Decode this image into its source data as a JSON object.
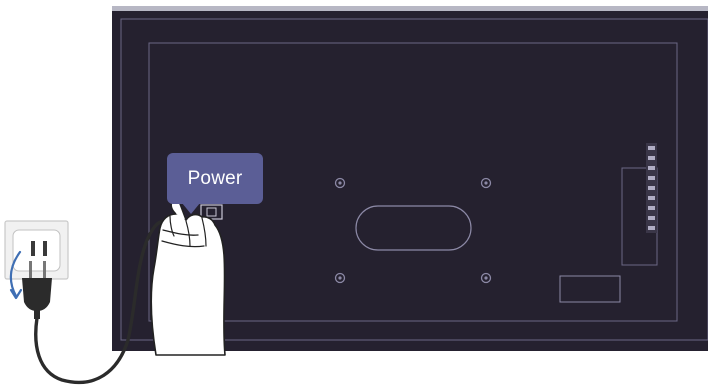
{
  "callout": {
    "label": "Power"
  },
  "colors": {
    "tv_back": "#25212f",
    "tv_edge": "#b5b5c3",
    "inner_line": "#6b6886",
    "callout_bg": "#5b5e96",
    "callout_text": "#ffffff",
    "cable": "#2b2b2b",
    "outlet": "#f1f1f1",
    "hand": "#ffffff"
  },
  "icons": {
    "vesa_hole": "circle-icon",
    "rotation_hint": "curved-arrow-icon"
  }
}
